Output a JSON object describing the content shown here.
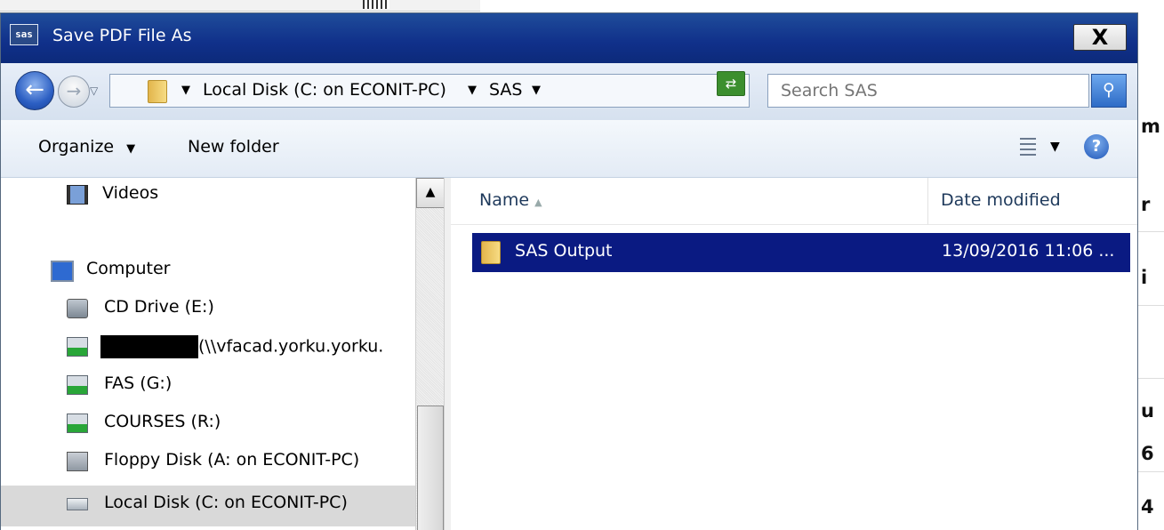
{
  "dialog": {
    "title": "Save PDF File As",
    "app_icon_text": "sas",
    "close_label": "X"
  },
  "addressbar": {
    "crumbs": [
      "Local Disk (C: on ECONIT-PC)",
      "SAS"
    ],
    "search_placeholder": "Search SAS"
  },
  "toolbar": {
    "organize_label": "Organize",
    "newfolder_label": "New folder",
    "help_label": "?"
  },
  "navpane": {
    "items": [
      {
        "label": "Videos",
        "icon": "film-icon"
      },
      {
        "label": "Computer",
        "icon": "computer-icon"
      },
      {
        "label": "CD Drive (E:)",
        "icon": "cd-drive-icon"
      },
      {
        "label": "(\\\\vfacad.yorku.yorku.",
        "icon": "network-drive-icon"
      },
      {
        "label": "FAS (G:)",
        "icon": "network-drive-icon"
      },
      {
        "label": "COURSES (R:)",
        "icon": "network-drive-icon"
      },
      {
        "label": "Floppy Disk (A: on ECONIT-PC)",
        "icon": "floppy-icon"
      },
      {
        "label": "Local Disk (C: on ECONIT-PC)",
        "icon": "disk-icon",
        "selected": true
      }
    ]
  },
  "filelist": {
    "columns": [
      "Name",
      "Date modified"
    ],
    "rows": [
      {
        "name": "SAS Output",
        "date": "13/09/2016 11:06 ...",
        "selected": true
      }
    ]
  },
  "background_window": {
    "fragments": [
      "m",
      "r",
      "i",
      "u",
      "6",
      "4"
    ]
  }
}
